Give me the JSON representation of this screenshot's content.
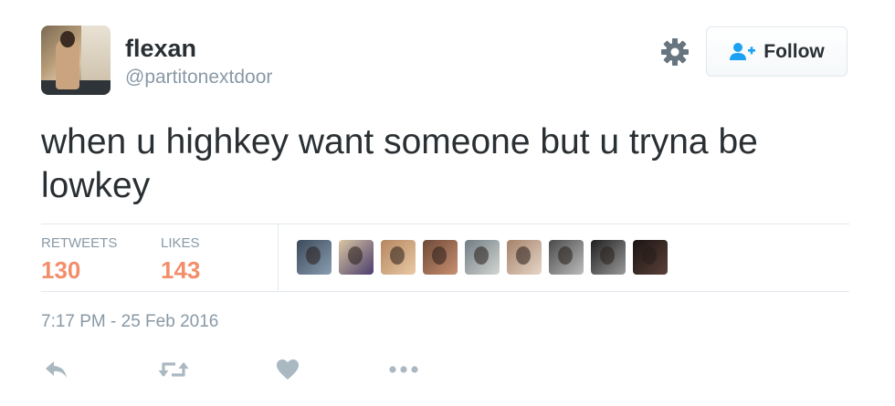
{
  "user": {
    "name": "flexan",
    "handle": "@partitonextdoor"
  },
  "follow_button": {
    "label": "Follow",
    "icon": "person-plus-icon"
  },
  "settings_icon": "gear-icon",
  "tweet": {
    "text": "when u highkey want someone but u tryna be lowkey",
    "timestamp": "7:17 PM - 25 Feb 2016"
  },
  "stats": {
    "retweets_label": "RETWEETS",
    "retweets_count": "130",
    "likes_label": "LIKES",
    "likes_count": "143"
  },
  "likers_count_shown": 9,
  "actions": [
    "reply-icon",
    "retweet-icon",
    "like-icon",
    "more-icon"
  ],
  "colors": {
    "count_accent": "#f38e6b",
    "follow_icon": "#1da1f2",
    "muted": "#8899a6",
    "icon_gray": "#aab8c2"
  }
}
